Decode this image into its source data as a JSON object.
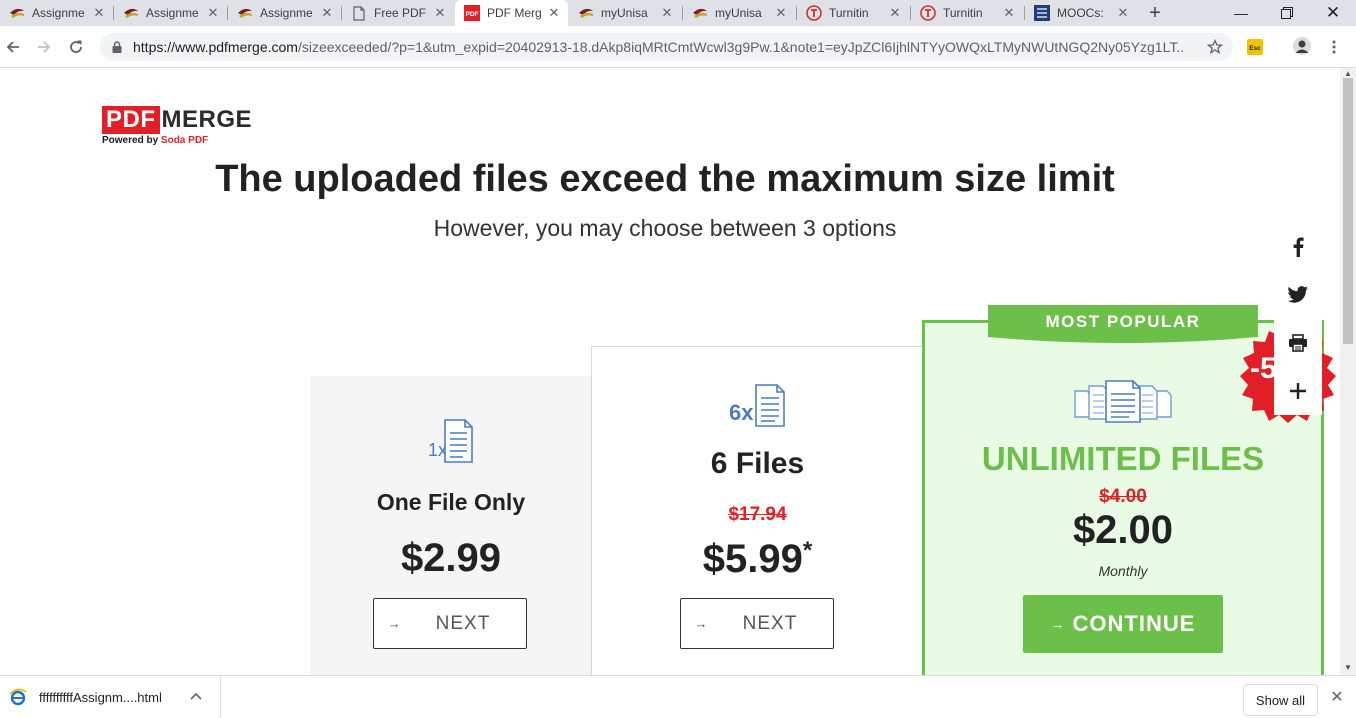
{
  "browser": {
    "tabs": [
      {
        "title": "Assignme",
        "icon": "unisa-icon",
        "active": false
      },
      {
        "title": "Assignme",
        "icon": "unisa-icon",
        "active": false
      },
      {
        "title": "Assignme",
        "icon": "unisa-icon",
        "active": false
      },
      {
        "title": "Free PDF",
        "icon": "document-icon",
        "active": false
      },
      {
        "title": "PDF Merg",
        "icon": "pdf-icon",
        "active": true
      },
      {
        "title": "myUnisa",
        "icon": "unisa-icon",
        "active": false
      },
      {
        "title": "myUnisa",
        "icon": "unisa-icon",
        "active": false
      },
      {
        "title": "Turnitin",
        "icon": "turnitin-icon",
        "active": false
      },
      {
        "title": "Turnitin",
        "icon": "turnitin-icon",
        "active": false
      },
      {
        "title": "MOOCs:",
        "icon": "ieee-icon",
        "active": false
      }
    ],
    "url_host": "https://www.pdfmerge.com",
    "url_rest": "/sizeexceeded/?p=1&utm_expid=20402913-18.dAkp8iqMRtCmtWcwl3g9Pw.1&note1=eyJpZCl6IjhlNTYyOWQxLTMyNWUtNGQ2Ny05Yzg1LT...",
    "ext_label": "Esc"
  },
  "page": {
    "logo_pdf": "PDF",
    "logo_merge": "MERGE",
    "powered_prefix": "Powered by",
    "powered_brand": "Soda PDF",
    "headline": "The uploaded files exceed the maximum size limit",
    "subline": "However, you may choose between 3 options",
    "plans": [
      {
        "icon_count": "1x",
        "name": "One File Only",
        "old_price": "",
        "price": "$2.99",
        "asterisk": "",
        "period": "",
        "button": "NEXT"
      },
      {
        "icon_count": "6x",
        "name": "6 Files",
        "old_price": "$17.94",
        "price": "$5.99",
        "asterisk": "*",
        "period": "",
        "button": "NEXT"
      },
      {
        "icon_count": "",
        "name": "UNLIMITED FILES",
        "old_price": "$4.00",
        "price": "$2.00",
        "asterisk": "",
        "period": "Monthly",
        "button": "CONTINUE"
      }
    ],
    "ribbon": "MOST POPULAR",
    "badge": "-50%",
    "colors": {
      "accent_green": "#6cc04a",
      "brand_red": "#e21f26",
      "icon_blue": "#4a7cc4"
    }
  },
  "downloads": {
    "file_name": "ffffffffffAssignm....html",
    "show_all": "Show all"
  }
}
